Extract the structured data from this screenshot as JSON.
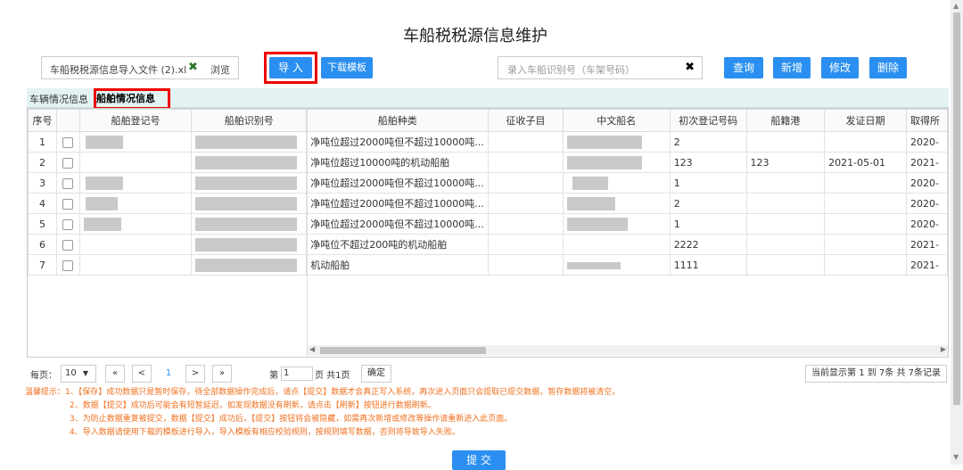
{
  "page_title": "车船税税源信息维护",
  "file": {
    "name": "车船税税源信息导入文件 (2).xl",
    "browse_label": "浏览"
  },
  "buttons": {
    "import": "导 入",
    "download_template": "下载模板",
    "query": "查询",
    "add": "新增",
    "edit": "修改",
    "delete": "删除",
    "submit": "提 交"
  },
  "search": {
    "placeholder": "录入车船识别号（车架号码）"
  },
  "tabs": {
    "vehicle": "车辆情况信息",
    "ship": "船舶情况信息"
  },
  "table": {
    "columns": [
      "序号",
      "",
      "船舶登记号",
      "船舶识别号",
      "船舶种类",
      "征收子目",
      "中文船名",
      "初次登记号码",
      "船籍港",
      "发证日期",
      "取得所"
    ],
    "rows": [
      {
        "no": "1",
        "type": "净吨位超过2000吨但不超过10000吨...",
        "first_reg": "2",
        "port": "",
        "date": "",
        "acq": "2020-"
      },
      {
        "no": "2",
        "type": "净吨位超过10000吨的机动船舶",
        "first_reg": "123",
        "port": "123",
        "date": "2021-05-01",
        "acq": "2021-"
      },
      {
        "no": "3",
        "type": "净吨位超过2000吨但不超过10000吨...",
        "first_reg": "1",
        "port": "",
        "date": "",
        "acq": "2020-"
      },
      {
        "no": "4",
        "type": "净吨位超过2000吨但不超过10000吨...",
        "first_reg": "2",
        "port": "",
        "date": "",
        "acq": "2020-"
      },
      {
        "no": "5",
        "type": "净吨位超过2000吨但不超过10000吨...",
        "first_reg": "1",
        "port": "",
        "date": "",
        "acq": "2020-"
      },
      {
        "no": "6",
        "type": "净吨位不超过200吨的机动船舶",
        "first_reg": "2222",
        "port": "",
        "date": "",
        "acq": "2021-"
      },
      {
        "no": "7",
        "type": "机动船舶",
        "first_reg": "1111",
        "port": "",
        "date": "",
        "acq": "2021-"
      }
    ]
  },
  "pager": {
    "per_page_label": "每页：",
    "per_page_value": "10",
    "first": "«",
    "prev": "<",
    "current": "1",
    "next": ">",
    "last": "»",
    "page_prefix": "第",
    "page_value": "1",
    "page_suffix": "页 共1页",
    "confirm": "确定",
    "summary": "当前显示第 1 到 7条 共 7条记录"
  },
  "tips": [
    "温馨提示：1、【保存】成功数据只是暂时保存，待全部数据操作完成后，请点【提交】数据才会真正写入系统，再次进入页面只会提取已提交数据，暂存数据将被清空。",
    "2、数据【提交】成功后可能会有短暂延迟，如发现数据没有刷新，请点击【刷新】按钮进行数据刷新。",
    "3、为防止数据重复被提交，数据【提交】成功后，【提交】按钮将会被隐藏，如需再次新增或修改等操作请重新进入此页面。",
    "4、导入数据请使用下载的模板进行导入，导入模板有相应校验规则，按规则填写数据，否则将导致导入失败。"
  ],
  "colors": {
    "button_blue": "#2a8ff0",
    "highlight_red": "#e00000",
    "tip_orange": "#f07020",
    "tab_bg": "#e3f3f2"
  }
}
